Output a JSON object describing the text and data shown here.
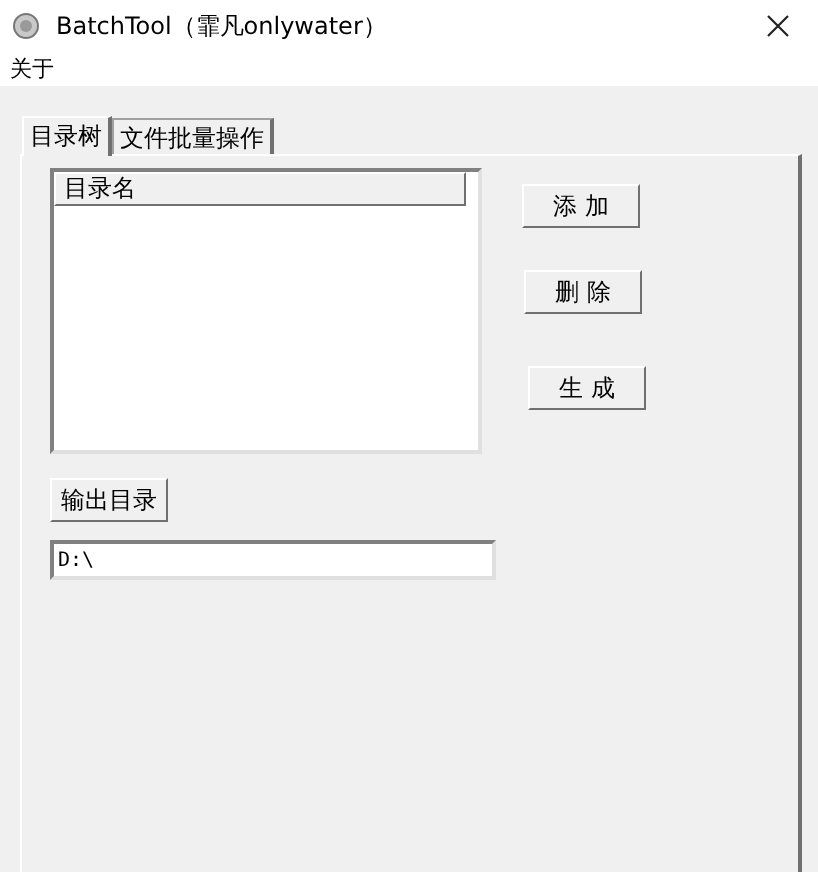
{
  "window": {
    "title": "BatchTool（霏凡onlywater）"
  },
  "menu": [
    "关于"
  ],
  "tabs": [
    {
      "label": "目录树",
      "selected": true
    },
    {
      "label": "文件批量操作",
      "selected": false
    }
  ],
  "list": {
    "columns": [
      "目录名"
    ]
  },
  "buttons": [
    "添 加",
    "删 除",
    "生 成"
  ],
  "output_button": "输出目录",
  "output_field": {
    "value": "D:\\"
  }
}
